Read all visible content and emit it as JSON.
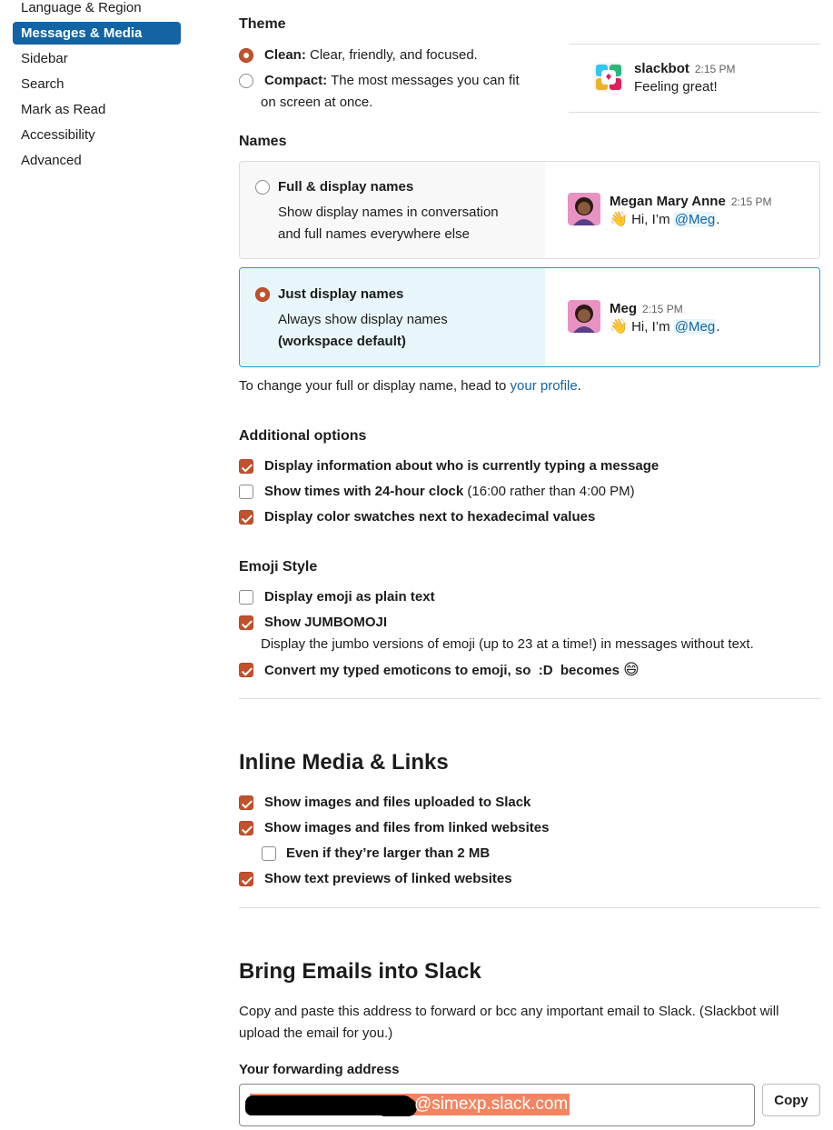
{
  "sidebar": {
    "items": [
      {
        "label": "Language & Region"
      },
      {
        "label": "Messages & Media"
      },
      {
        "label": "Sidebar"
      },
      {
        "label": "Search"
      },
      {
        "label": "Mark as Read"
      },
      {
        "label": "Accessibility"
      },
      {
        "label": "Advanced"
      }
    ],
    "active_index": 1
  },
  "theme": {
    "heading": "Theme",
    "clean": {
      "bold": "Clean:",
      "desc": "Clear, friendly, and focused.",
      "selected": true
    },
    "compact": {
      "bold": "Compact:",
      "desc": "The most messages you can fit",
      "desc2": "on screen at once.",
      "selected": false
    },
    "preview": {
      "name": "slackbot",
      "time": "2:15 PM",
      "text": "Feeling great!"
    }
  },
  "names": {
    "heading": "Names",
    "full": {
      "label": "Full & display names",
      "desc1": "Show display names in conversation",
      "desc2": "and full names everywhere else",
      "selected": false,
      "preview": {
        "name": "Megan Mary Anne",
        "time": "2:15 PM",
        "text": "Hi, I’m",
        "mention": "@Meg",
        "end": "."
      }
    },
    "just": {
      "label": "Just display names",
      "desc1": "Always show display names",
      "desc2": "(workspace default)",
      "selected": true,
      "preview": {
        "name": "Meg",
        "time": "2:15 PM",
        "text": "Hi, I’m",
        "mention": "@Meg",
        "end": "."
      }
    },
    "change_text": "To change your full or display name, head to",
    "change_link": "your profile",
    "change_end": "."
  },
  "additional": {
    "heading": "Additional options",
    "typing": {
      "label": "Display information about who is currently typing a message",
      "checked": true
    },
    "clock": {
      "label": "Show times with 24-hour clock",
      "extra": "(16:00 rather than 4:00 PM)",
      "checked": false
    },
    "swatches": {
      "label": "Display color swatches next to hexadecimal values",
      "checked": true
    }
  },
  "emoji": {
    "heading": "Emoji Style",
    "plain": {
      "label": "Display emoji as plain text",
      "checked": false
    },
    "jumbo": {
      "label": "Show JUMBOMOJI",
      "desc": "Display the jumbo versions of emoji (up to 23 at a time!) in messages without text.",
      "checked": true
    },
    "convert": {
      "label": "Convert my typed emoticons to emoji, so  :D  becomes",
      "glyph": "😄",
      "checked": true
    }
  },
  "inline": {
    "heading": "Inline Media & Links",
    "uploaded": {
      "label": "Show images and files uploaded to Slack",
      "checked": true
    },
    "linked": {
      "label": "Show images and files from linked websites",
      "checked": true
    },
    "larger": {
      "label": "Even if they’re larger than 2 MB",
      "checked": false
    },
    "previews": {
      "label": "Show text previews of linked websites",
      "checked": true
    }
  },
  "emails": {
    "heading": "Bring Emails into Slack",
    "desc": "Copy and paste this address to forward or bcc any important email to Slack. (Slackbot will upload the email for you.)",
    "address_label": "Your forwarding address",
    "address_visible": "@simexp.slack.com",
    "copy_label": "Copy"
  },
  "colors": {
    "accent": "#1264a3",
    "checkbox": "#c0522d",
    "selection": "#f4845f",
    "selected_box_bg": "#e8f5fa"
  }
}
